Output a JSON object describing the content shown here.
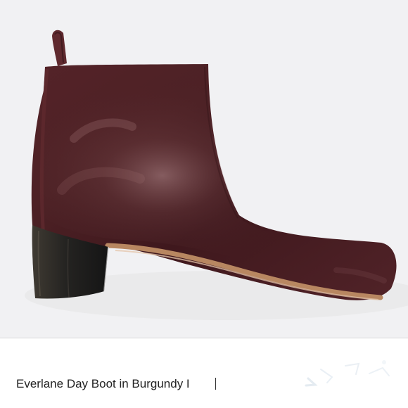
{
  "listing": {
    "image_alt": "Burgundy leather ankle boot",
    "title": "Everlane Day Boot in Burgundy I"
  },
  "colors": {
    "boot_burgundy": "#4b2024",
    "boot_highlight": "#7a4a4c",
    "heel_stack": "#2b2925",
    "sole_edge": "#b88761",
    "background": "#f1f1f3"
  },
  "icons": {
    "photo": "product-photo",
    "mark": "faint-decorative-mark"
  }
}
